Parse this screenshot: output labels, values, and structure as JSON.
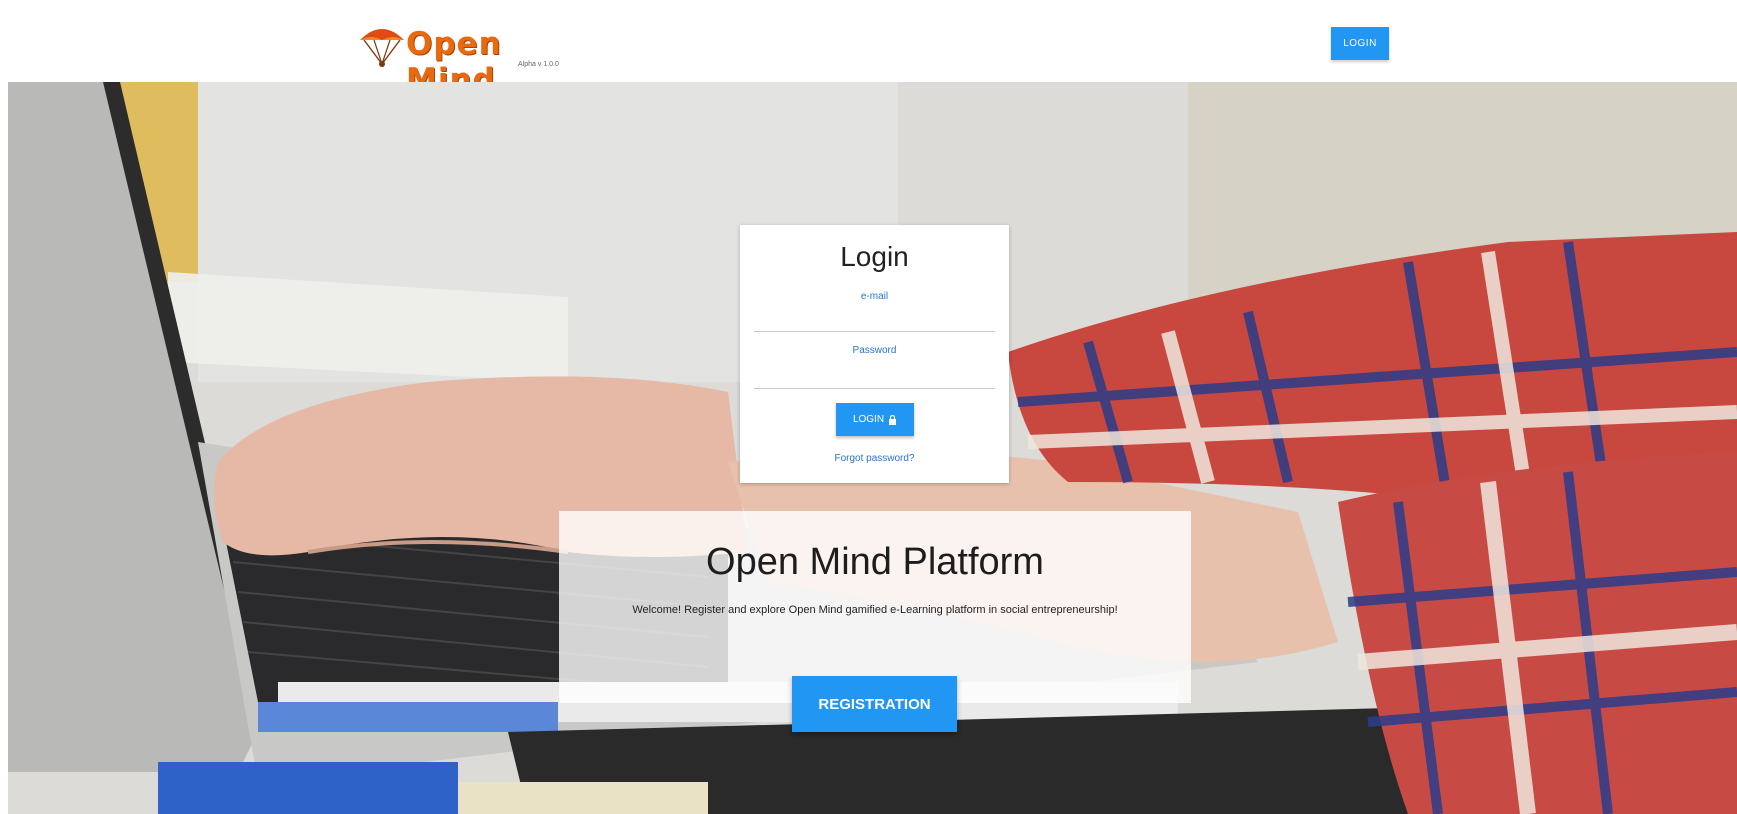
{
  "header": {
    "brand": "Open Mind",
    "tagline": "Alpha v 1.0.0",
    "login_label": "LOGIN"
  },
  "login_card": {
    "title": "Login",
    "email_label": "e-mail",
    "password_label": "Password",
    "login_button": "LOGIN",
    "forgot_link": "Forgot password?"
  },
  "platform": {
    "title": "Open Mind Platform",
    "description": "Welcome! Register and explore Open Mind gamified e-Learning platform in social entrepreneurship!",
    "registration_button": "REGISTRATION"
  },
  "colors": {
    "accent": "#2196f3",
    "brand": "#e86a10",
    "link": "#2a74c7"
  },
  "icons": {
    "login_button_icon": "lock-icon",
    "logo_icon": "parachute-icon"
  }
}
